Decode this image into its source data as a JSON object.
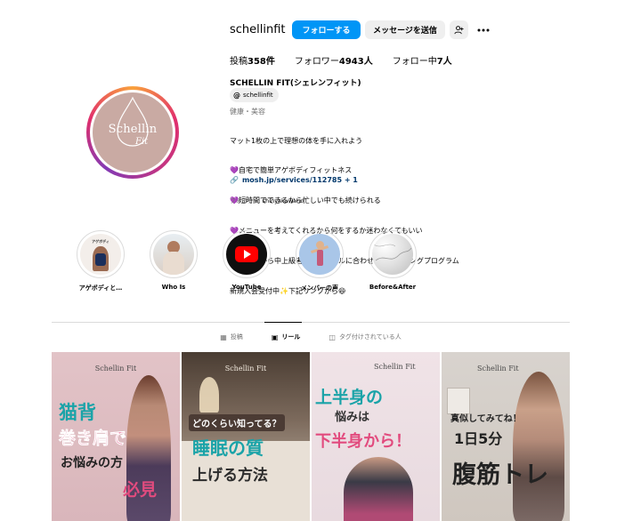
{
  "profile": {
    "username": "schellinfit",
    "follow_label": "フォローする",
    "message_label": "メッセージを送信",
    "add_user_icon": "add-user-icon",
    "more_icon": "more-icon",
    "stats": {
      "posts_label": "投稿",
      "posts_value": "358件",
      "followers_label": "フォロワー",
      "followers_value": "4943人",
      "following_label": "フォロー中",
      "following_value": "7人"
    },
    "full_name": "SCHELLIN FIT(シェレンフィット)",
    "threads_handle": "schellinfit",
    "category": "健康・美容",
    "bio_lines": [
      "マット1枚の上で理想の体を手に入れよう",
      "💜自宅で簡単アゲボディフィットネス",
      "💜短時間でできるから忙しい中でも続けられる",
      "💜メニューを考えてくれるから何をするか迷わなくてもいい",
      "💜初心者から中上級者全てのレベルに合わせたトレーニングプログラム",
      "新規入会受付中✨下記リンクから😆"
    ],
    "link_text": "mosh.jp/services/112785 + 1",
    "followed_by_label": "フォロワー:",
    "followed_by_user": "shinyakuwano",
    "avatar_logo_main": "Schellin",
    "avatar_logo_sub": "Fit"
  },
  "highlights": [
    {
      "label": "アゲボディと…",
      "thumb_text": "アゲボディ"
    },
    {
      "label": "Who Is"
    },
    {
      "label": "YouTube"
    },
    {
      "label": "メンバーの声"
    },
    {
      "label": "Before&After"
    }
  ],
  "tabs": [
    {
      "label": "投稿",
      "icon": "grid-icon",
      "active": false
    },
    {
      "label": "リール",
      "icon": "reels-icon",
      "active": true
    },
    {
      "label": "タグ付けされている人",
      "icon": "tagged-icon",
      "active": false
    }
  ],
  "grid": [
    {
      "brand": "Schellin Fit",
      "lines": [
        "猫背",
        "巻き肩で",
        "お悩みの方",
        "必見"
      ]
    },
    {
      "brand": "Schellin Fit",
      "lines": [
        "どのくらい知ってる？",
        "睡眠の質",
        "上げる方法"
      ]
    },
    {
      "brand": "Schellin Fit",
      "lines": [
        "上半身の",
        "悩みは",
        "下半身から！"
      ]
    },
    {
      "brand": "Schellin Fit",
      "lines": [
        "真似してみてね！",
        "1日5分",
        "腹筋トレ"
      ]
    }
  ],
  "colors": {
    "follow_button": "#0095f6",
    "secondary_button": "#efefef",
    "link": "#00376b",
    "avatar_bg": "#c9aaa3"
  }
}
